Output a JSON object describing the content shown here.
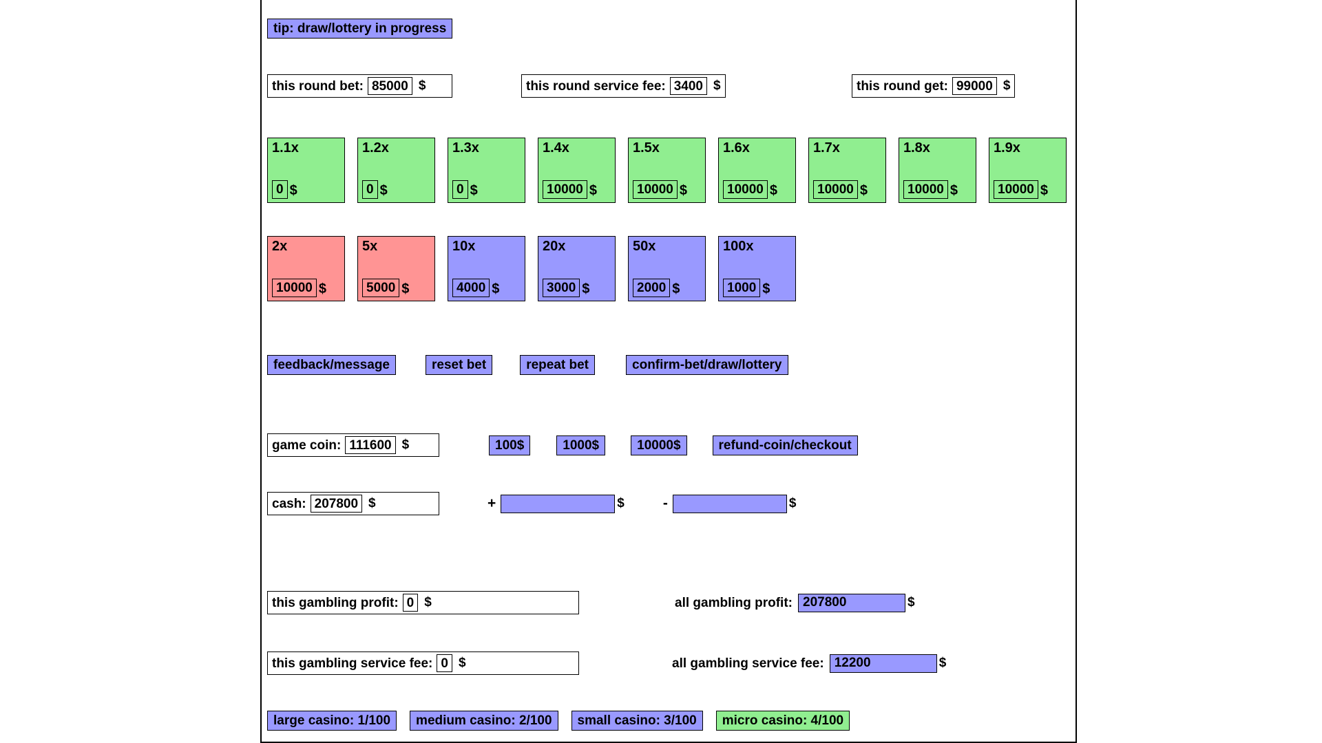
{
  "tip": {
    "text": "tip: draw/lottery in progress"
  },
  "round_stats": [
    {
      "name": "this-round-bet",
      "label": "this round bet:",
      "value": "85000",
      "unit": "$"
    },
    {
      "name": "this-round-service-fee",
      "label": "this round service fee:",
      "value": "3400",
      "unit": "$"
    },
    {
      "name": "this-round-get",
      "label": "this round get:",
      "value": "99000",
      "unit": "$"
    }
  ],
  "bet_tiles_row1": [
    {
      "multiplier": "1.1x",
      "amount": "0",
      "unit": "$",
      "color": "green"
    },
    {
      "multiplier": "1.2x",
      "amount": "0",
      "unit": "$",
      "color": "green"
    },
    {
      "multiplier": "1.3x",
      "amount": "0",
      "unit": "$",
      "color": "green"
    },
    {
      "multiplier": "1.4x",
      "amount": "10000",
      "unit": "$",
      "color": "green"
    },
    {
      "multiplier": "1.5x",
      "amount": "10000",
      "unit": "$",
      "color": "green"
    },
    {
      "multiplier": "1.6x",
      "amount": "10000",
      "unit": "$",
      "color": "green"
    },
    {
      "multiplier": "1.7x",
      "amount": "10000",
      "unit": "$",
      "color": "green"
    },
    {
      "multiplier": "1.8x",
      "amount": "10000",
      "unit": "$",
      "color": "green"
    },
    {
      "multiplier": "1.9x",
      "amount": "10000",
      "unit": "$",
      "color": "green"
    }
  ],
  "bet_tiles_row2": [
    {
      "multiplier": "2x",
      "amount": "10000",
      "unit": "$",
      "color": "red"
    },
    {
      "multiplier": "5x",
      "amount": "5000",
      "unit": "$",
      "color": "red"
    },
    {
      "multiplier": "10x",
      "amount": "4000",
      "unit": "$",
      "color": "blue"
    },
    {
      "multiplier": "20x",
      "amount": "3000",
      "unit": "$",
      "color": "blue"
    },
    {
      "multiplier": "50x",
      "amount": "2000",
      "unit": "$",
      "color": "blue"
    },
    {
      "multiplier": "100x",
      "amount": "1000",
      "unit": "$",
      "color": "blue"
    }
  ],
  "actions": {
    "feedback": "feedback/message",
    "reset_bet": "reset bet",
    "repeat_bet": "repeat bet",
    "confirm_bet": "confirm-bet/draw/lottery"
  },
  "coin_row": {
    "label": "game coin:",
    "value": "111600",
    "unit": "$",
    "quick_amounts": [
      "100$",
      "1000$",
      "10000$"
    ],
    "refund_label": "refund-coin/checkout"
  },
  "cash_row": {
    "label": "cash:",
    "value": "207800",
    "unit": "$",
    "add_sign": "+",
    "add_value": "",
    "add_unit": "$",
    "sub_sign": "-",
    "sub_value": "",
    "sub_unit": "$"
  },
  "profit_row": {
    "this_label": "this gambling profit:",
    "this_value": "0",
    "this_unit": "$",
    "all_label": "all gambling profit:",
    "all_value": "207800",
    "all_unit": "$"
  },
  "fee_row": {
    "this_label": "this gambling service fee:",
    "this_value": "0",
    "this_unit": "$",
    "all_label": "all gambling service fee:",
    "all_value": "12200",
    "all_unit": "$"
  },
  "casino_tabs": [
    {
      "label": "large casino: 1/100",
      "active": false
    },
    {
      "label": "medium casino: 2/100",
      "active": false
    },
    {
      "label": "small casino: 3/100",
      "active": false
    },
    {
      "label": "micro casino: 4/100",
      "active": true
    }
  ],
  "colors": {
    "green": "#90ee90",
    "red": "#ff9494",
    "purple": "#9999ff",
    "border": "#000000"
  }
}
